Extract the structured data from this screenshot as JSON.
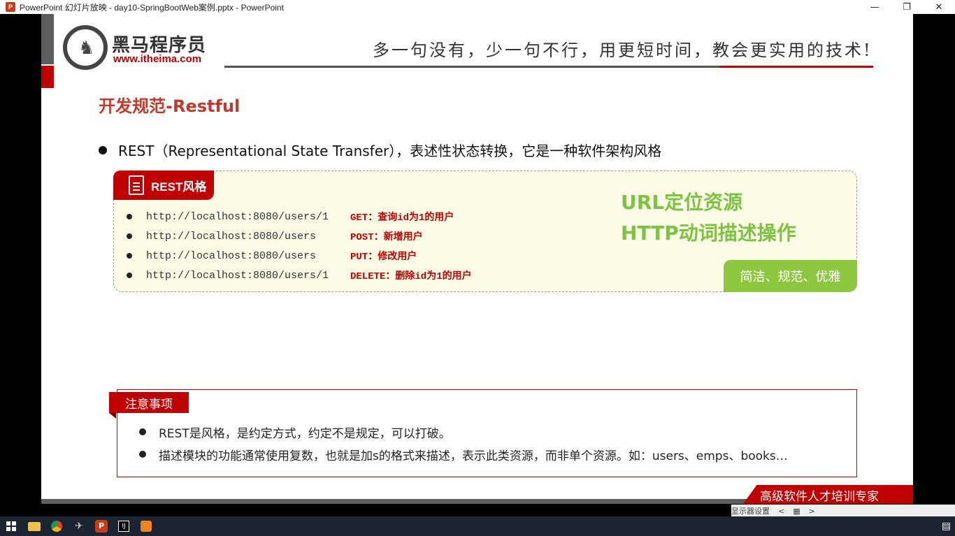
{
  "window": {
    "title": "PowerPoint 幻灯片放映  -  day10-SpringBootWeb案例.pptx - PowerPoint",
    "logo_text": "P",
    "minimize": "—",
    "maximize": "❐",
    "close": "✕"
  },
  "slide": {
    "logo_cn": "黑马程序员",
    "logo_url": "www.itheima.com",
    "slogan": "多一句没有，少一句不行，用更短时间，教会更实用的技术!",
    "title": "开发规范-Restful",
    "main_bullet": "REST（Representational State Transfer），表述性状态转换，它是一种软件架构风格",
    "rest_tab_label": "REST风格",
    "apis": [
      {
        "url": "http://localhost:8080/users/1",
        "desc": "GET：查询id为1的用户"
      },
      {
        "url": "http://localhost:8080/users",
        "desc": "POST：新增用户"
      },
      {
        "url": "http://localhost:8080/users",
        "desc": "PUT：修改用户"
      },
      {
        "url": "http://localhost:8080/users/1",
        "desc": "DELETE：删除id为1的用户"
      }
    ],
    "big_note_line1": "URL定位资源",
    "big_note_line2": "HTTP动词描述操作",
    "green_badge": "简洁、规范、优雅",
    "notes_tab": "注意事项",
    "notes": [
      "REST是风格，是约定方式，约定不是规定，可以打破。",
      "描述模块的功能通常使用复数，也就是加s的格式来描述，表示此类资源，而非单个资源。如：users、emps、books…"
    ],
    "footer_text": "高级软件人才培训专家"
  },
  "controls": {
    "display_settings": "显示器设置",
    "prev": "<",
    "grid": "▦",
    "next": ">"
  },
  "taskbar": {
    "ppt_label": "P",
    "idea_label": "IJ"
  },
  "colors": {
    "accent_red": "#c00000",
    "accent_green": "#8dc63f",
    "note_green": "#7cc243"
  }
}
